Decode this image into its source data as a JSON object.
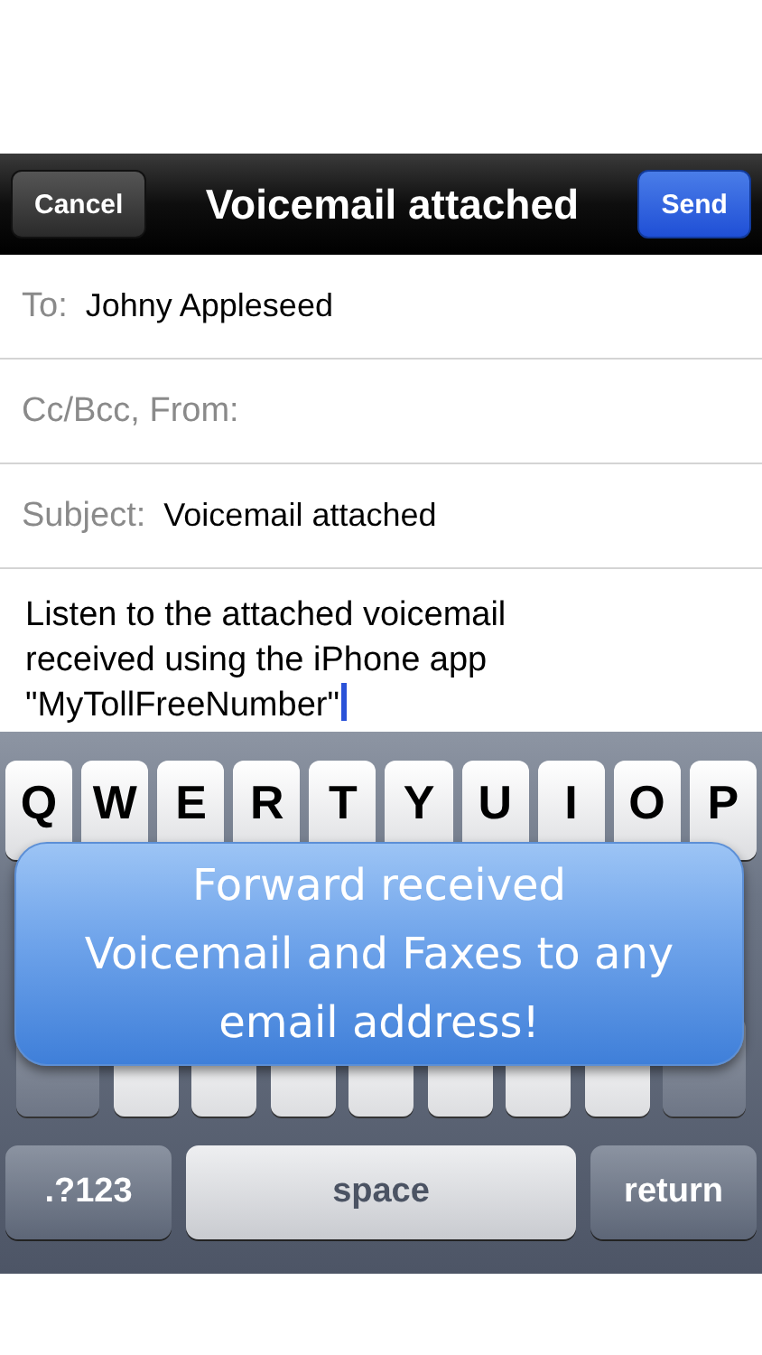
{
  "nav_bar": {
    "cancel": "Cancel",
    "title": "Voicemail attached",
    "send": "Send"
  },
  "fields": [
    {
      "label": "To:",
      "value": "Johny Appleseed"
    },
    {
      "label": "Cc/Bcc, From:"
    },
    {
      "label": "Subject:",
      "value": "Voicemail attached"
    }
  ],
  "body": "Listen to the attached voicemail received using the iPhone app \"MyTollFreeNumber\"",
  "keyboard": {
    "top_row": [
      "Q",
      "W",
      "E",
      "R",
      "T",
      "Y",
      "U",
      "I",
      "O",
      "P"
    ],
    "bottom_row": [
      {
        "kind": "mode",
        "label": ".?123"
      },
      {
        "kind": "space",
        "label": "space"
      },
      {
        "kind": "return",
        "label": "return"
      }
    ]
  },
  "callout": {
    "lines": [
      "Forward received",
      "Voicemail and Faxes to any",
      "email address!"
    ]
  }
}
